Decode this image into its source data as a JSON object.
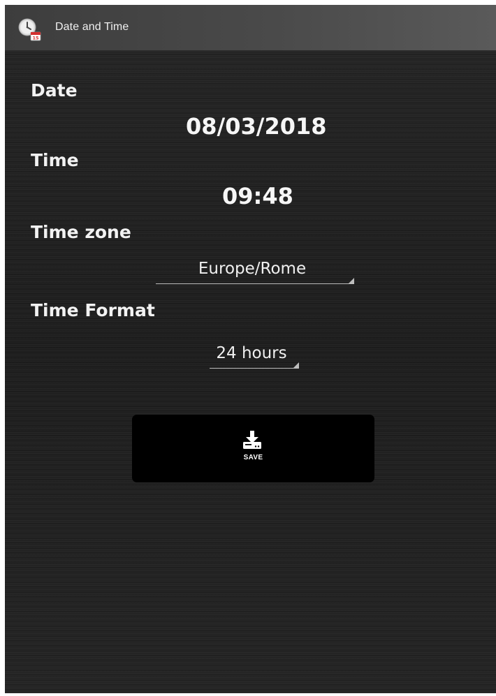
{
  "app": {
    "title": "Date and Time",
    "icon": "clock-calendar-icon",
    "calendar_badge": "15"
  },
  "fields": {
    "date_label": "Date",
    "date_value": "08/03/2018",
    "time_label": "Time",
    "time_value": "09:48",
    "timezone_label": "Time zone",
    "timezone_value": "Europe/Rome",
    "format_label": "Time Format",
    "format_value": "24 hours"
  },
  "save_button": {
    "label": "SAVE",
    "icon": "download-icon"
  },
  "colors": {
    "background": "#222222",
    "titlebar": "#4a4a4a",
    "button": "#000000",
    "text": "#f2f2f2",
    "badge": "#d32f2f"
  }
}
